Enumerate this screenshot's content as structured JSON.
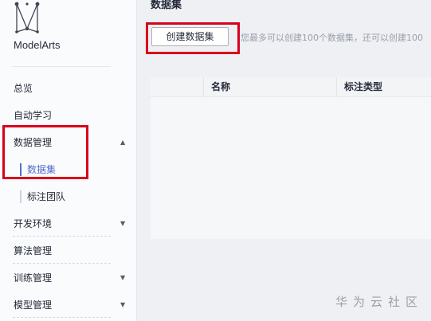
{
  "app": {
    "brand": "ModelArts"
  },
  "sidebar": {
    "items": [
      {
        "label": "总览",
        "caret": ""
      },
      {
        "label": "自动学习",
        "caret": ""
      },
      {
        "label": "数据管理",
        "caret": "▲"
      },
      {
        "label": "数据集",
        "caret": ""
      },
      {
        "label": "标注团队",
        "caret": ""
      },
      {
        "label": "开发环境",
        "caret": "▼"
      },
      {
        "label": "算法管理",
        "caret": ""
      },
      {
        "label": "训练管理",
        "caret": "▼"
      },
      {
        "label": "模型管理",
        "caret": "▼"
      }
    ]
  },
  "main": {
    "title": "数据集",
    "create_button": "创建数据集",
    "hint": "您最多可以创建100个数据集，还可以创建100",
    "table": {
      "columns": [
        "名称",
        "标注类型"
      ]
    }
  },
  "watermark": "华为云社区",
  "colors": {
    "accent": "#526ecc",
    "highlight": "#d9001b"
  }
}
